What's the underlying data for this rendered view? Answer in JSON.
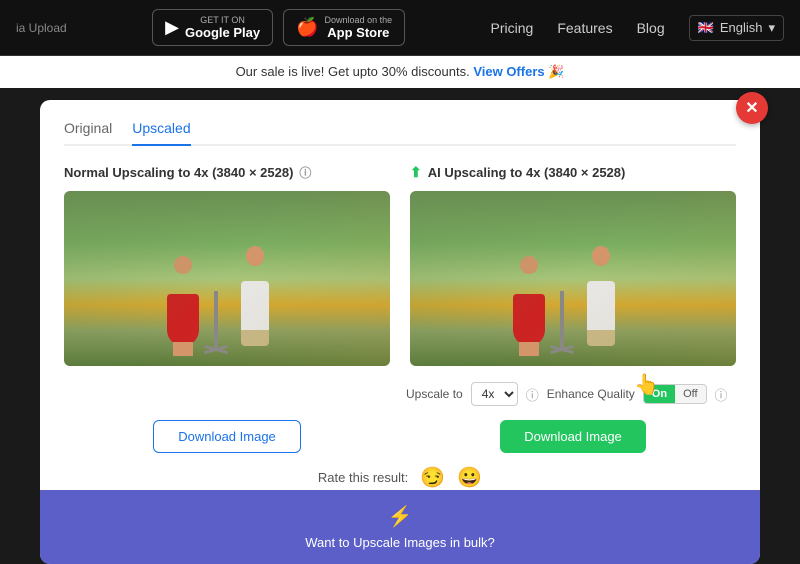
{
  "header": {
    "tab_title": "ia Upload",
    "google_play": {
      "get_it_on": "GET IT ON",
      "name": "Google Play"
    },
    "app_store": {
      "download_on": "Download on the",
      "name": "App Store"
    },
    "nav": {
      "pricing": "Pricing",
      "features": "Features",
      "blog": "Blog",
      "lang": "English"
    }
  },
  "sale_banner": {
    "text": "Our sale is live! Get upto 30% discounts.",
    "link": "View Offers",
    "emoji": "🎉"
  },
  "main": {
    "tabs": [
      {
        "label": "Original",
        "active": false
      },
      {
        "label": "Upscaled",
        "active": true
      }
    ],
    "left_panel": {
      "title": "Normal Upscaling to 4x (3840 × 2528)",
      "download_btn": "Download Image"
    },
    "right_panel": {
      "title": "AI Upscaling to 4x (3840 × 2528)",
      "upscale_label": "Upscale to",
      "upscale_value": "4x",
      "quality_label": "Enhance Quality",
      "toggle_on": "On",
      "toggle_off": "Off",
      "download_btn": "Download Image"
    },
    "rating": {
      "label": "Rate this result:",
      "emoji1": "😏",
      "emoji2": "😀"
    },
    "bulk_banner": {
      "icon": "⚡",
      "text": "Want to Upscale Images in bulk?"
    }
  }
}
